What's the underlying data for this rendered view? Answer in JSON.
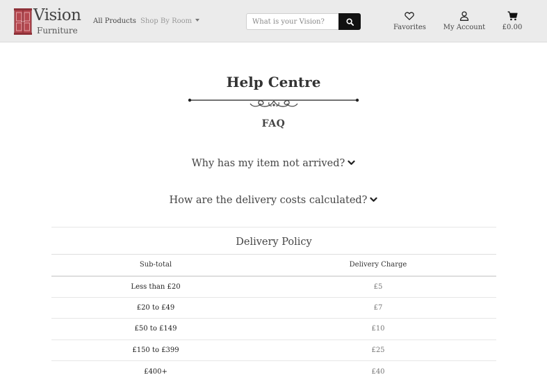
{
  "brand": {
    "title": "Vision",
    "subtitle": "Furniture"
  },
  "nav": {
    "all_products": "All Products",
    "shop_by_room": "Shop By Room"
  },
  "search": {
    "placeholder": "What is your Vision?",
    "value": ""
  },
  "header_actions": {
    "favorites": "Favorites",
    "account": "My Account",
    "cart_total": "£0.00"
  },
  "main": {
    "title": "Help Centre",
    "faq_heading": "FAQ",
    "questions": [
      "Why has my item not arrived?",
      "How are the delivery costs calculated?"
    ]
  },
  "delivery_policy": {
    "title": "Delivery Policy",
    "columns": [
      "Sub-total",
      "Delivery Charge"
    ],
    "rows": [
      {
        "subtotal": "Less than £20",
        "charge": "£5"
      },
      {
        "subtotal": "£20 to £49",
        "charge": "£7"
      },
      {
        "subtotal": "£50 to £149",
        "charge": "£10"
      },
      {
        "subtotal": "£150 to £399",
        "charge": "£25"
      },
      {
        "subtotal": "£400+",
        "charge": "£40"
      }
    ]
  },
  "colors": {
    "navbar_bg": "#ebebeb",
    "logo_red": "#b5474f",
    "search_button": "#111111",
    "text": "#333333",
    "charge_text": "#777777"
  },
  "icons": [
    "wardrobe-logo-icon",
    "search-icon",
    "heart-icon",
    "user-icon",
    "cart-icon",
    "chevron-down-icon",
    "ornament-divider"
  ]
}
